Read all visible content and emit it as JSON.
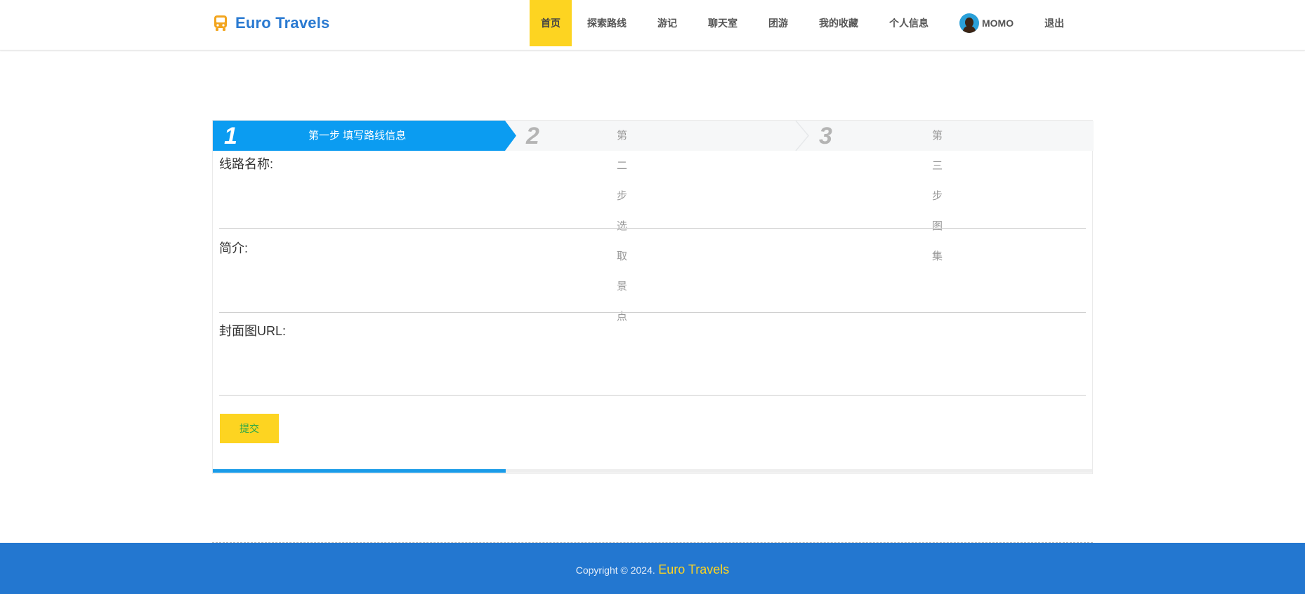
{
  "brand": {
    "name": "Euro Travels",
    "icon": "bus-icon",
    "color": "#2a7ad1",
    "icon_color": "#f2a51f"
  },
  "nav": {
    "items": [
      {
        "label": "首页",
        "active": true
      },
      {
        "label": "探索路线"
      },
      {
        "label": "游记"
      },
      {
        "label": "聊天室"
      },
      {
        "label": "团游"
      },
      {
        "label": "我的收藏"
      },
      {
        "label": "个人信息"
      }
    ],
    "user": "MOMO",
    "logout": "退出",
    "active_color": "#fdd421"
  },
  "wizard": {
    "steps": [
      {
        "number": "1",
        "label": "第一步 填写路线信息",
        "active": true
      },
      {
        "number": "2",
        "label": "第二步 选取景点"
      },
      {
        "number": "3",
        "label": "第三步 图集"
      }
    ],
    "active_color": "#0b9cf1",
    "progress": 0.333
  },
  "form": {
    "route_name": {
      "label": "线路名称:",
      "value": ""
    },
    "intro": {
      "label": "简介:",
      "value": ""
    },
    "cover_url": {
      "label": "封面图URL:",
      "value": ""
    },
    "submit_label": "提交"
  },
  "footer": {
    "copyright": "Copyright © 2024.",
    "brand": "Euro Travels",
    "bg_color": "#2377d0"
  }
}
